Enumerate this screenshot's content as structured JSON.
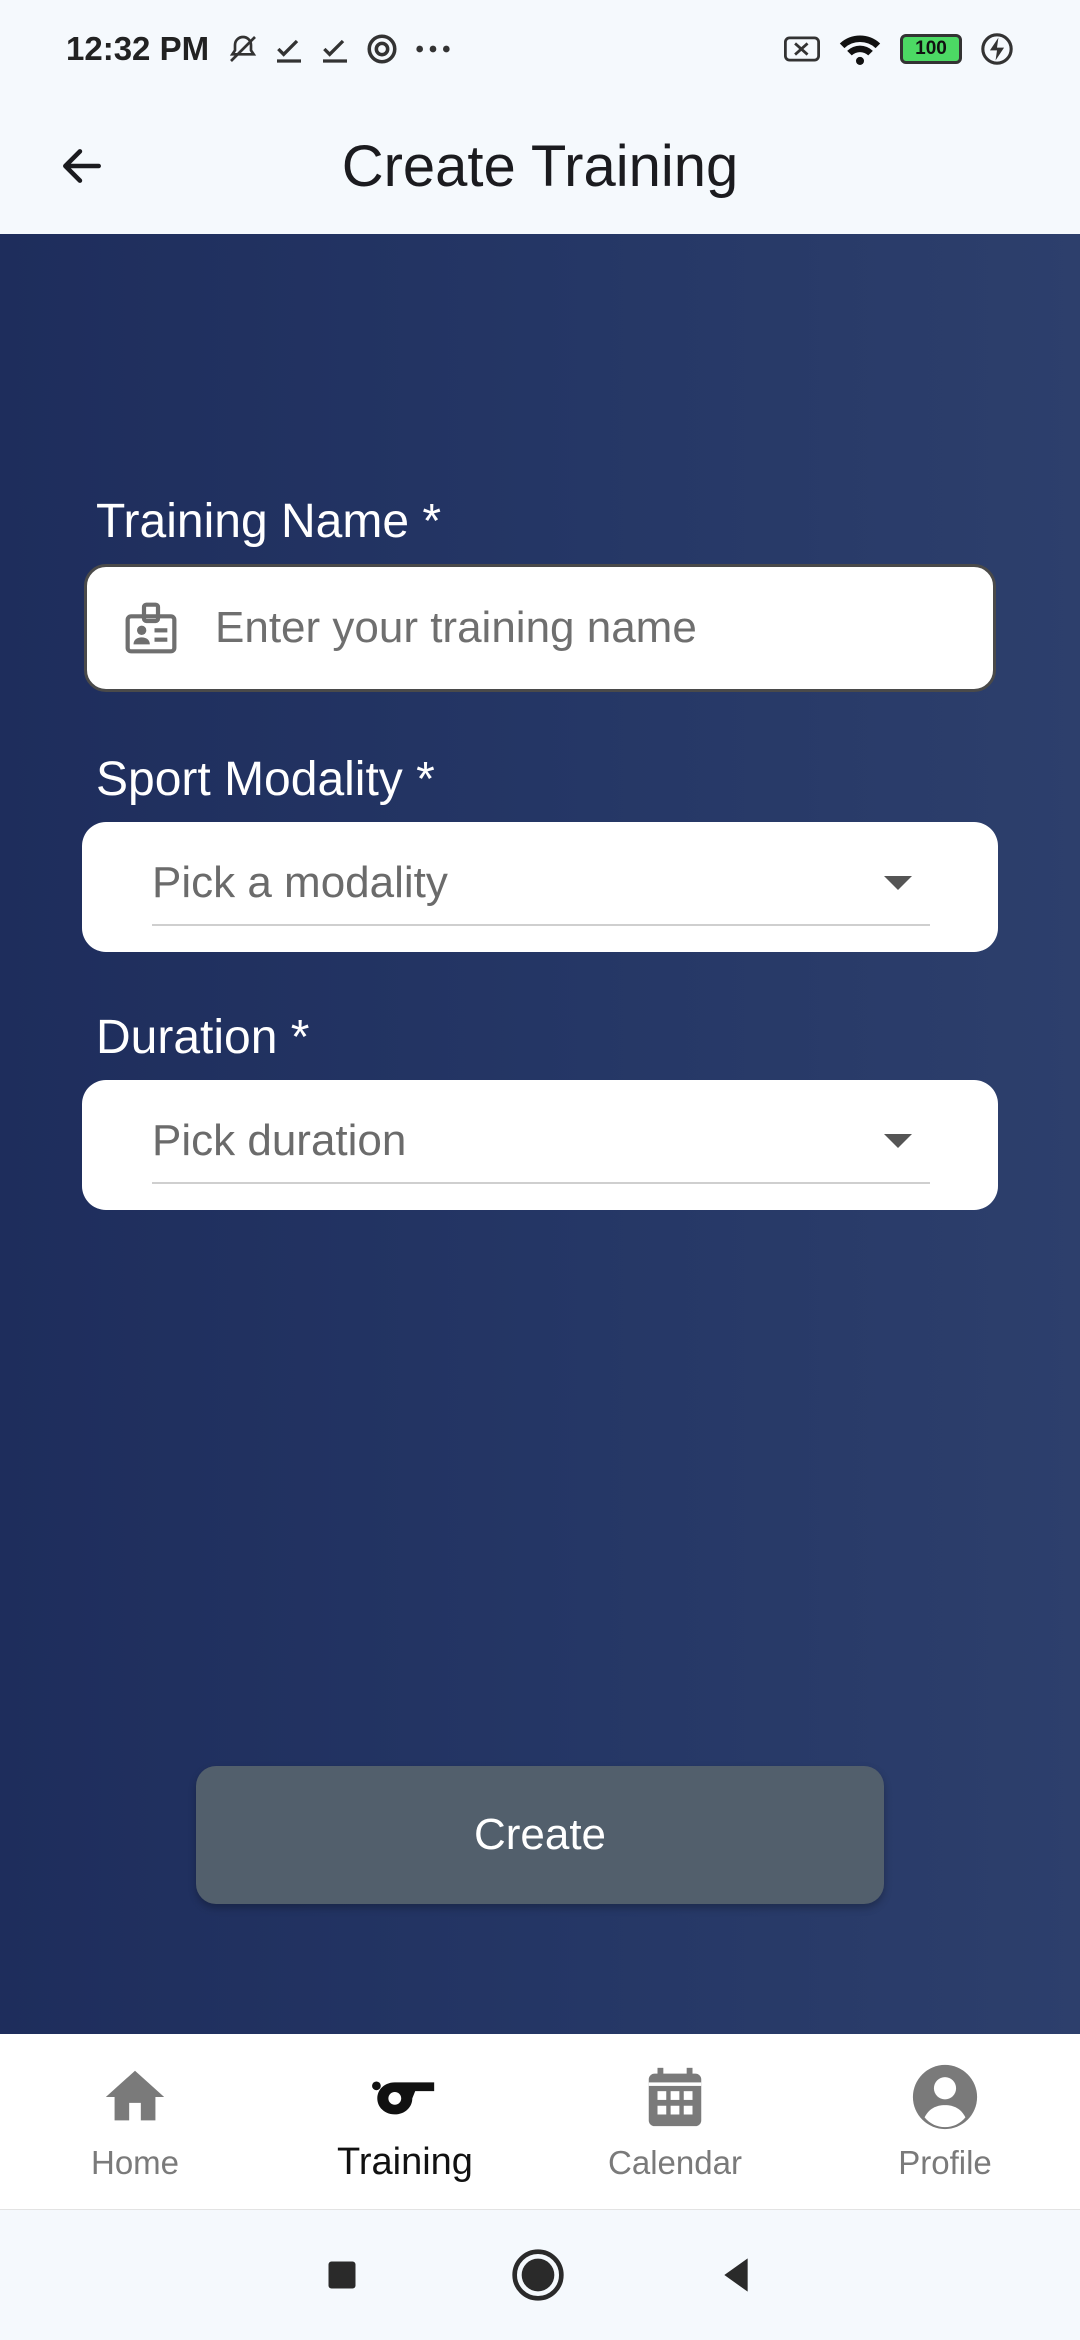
{
  "status_bar": {
    "time": "12:32 PM",
    "battery": "100"
  },
  "app_bar": {
    "title": "Create Training"
  },
  "form": {
    "training_name": {
      "label": "Training Name *",
      "placeholder": "Enter your training name"
    },
    "sport_modality": {
      "label": "Sport Modality *",
      "placeholder": "Pick a modality"
    },
    "duration": {
      "label": "Duration *",
      "placeholder": "Pick duration"
    },
    "create_button": "Create"
  },
  "bottom_nav": {
    "items": [
      {
        "label": "Home",
        "icon": "home-icon",
        "active": false
      },
      {
        "label": "Training",
        "icon": "whistle-icon",
        "active": true
      },
      {
        "label": "Calendar",
        "icon": "calendar-icon",
        "active": false
      },
      {
        "label": "Profile",
        "icon": "profile-icon",
        "active": false
      }
    ]
  },
  "colors": {
    "background_gradient_start": "#1e2d5c",
    "background_gradient_end": "#2d3f6c",
    "create_button": "#525f6c",
    "battery_fill": "#4cd964"
  }
}
